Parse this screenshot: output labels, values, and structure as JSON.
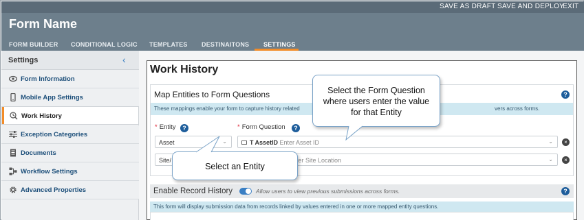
{
  "topbar": {
    "actions": [
      "SAVE AS DRAFT",
      "SAVE AND DEPLOY",
      "EXIT"
    ]
  },
  "header": {
    "form_name": "Form Name",
    "tabs": [
      "FORM BUILDER",
      "CONDITIONAL LOGIC",
      "TEMPLATES",
      "DESTINAITONS",
      "SETTINGS"
    ],
    "active_tab": "SETTINGS"
  },
  "sidebar": {
    "title": "Settings",
    "collapse_icon": "chevron-left-icon",
    "items": [
      {
        "label": "Form Information",
        "icon": "eye-icon"
      },
      {
        "label": "Mobile App Settings",
        "icon": "mobile-icon"
      },
      {
        "label": "Work History",
        "icon": "history-icon",
        "active": true
      },
      {
        "label": "Exception Categories",
        "icon": "sliders-icon"
      },
      {
        "label": "Documents",
        "icon": "document-icon"
      },
      {
        "label": "Workflow Settings",
        "icon": "workflow-icon"
      },
      {
        "label": "Advanced Properties",
        "icon": "gear-icon"
      }
    ]
  },
  "main": {
    "title": "Work History",
    "map_card": {
      "title": "Map Entities to Form Questions",
      "info_left": "These mappings enable your form to capture history related",
      "info_right": "vers across forms.",
      "entity_label": "Entity",
      "question_label": "Form Question",
      "rows": [
        {
          "entity": "Asset",
          "question_type": "T",
          "question_name": "AssetID",
          "question_placeholder": "Enter Asset ID"
        },
        {
          "entity": "Site/",
          "question_placeholder": "nter Site Location"
        }
      ]
    },
    "record_history": {
      "title": "Enable Record History",
      "description": "Allow users to view previous submissions across forms.",
      "info": "This form will display submission data from records linked by values entered in one or more mapped entity questions."
    }
  },
  "callouts": {
    "form_question": "Select the Form Question where users enter the value for that Entity",
    "entity": "Select an Entity"
  },
  "colors": {
    "accent": "#f28c28",
    "header": "#6d7f8c",
    "topbar": "#5b6b78",
    "link": "#1d4f7a",
    "info": "#cfe8f1"
  }
}
